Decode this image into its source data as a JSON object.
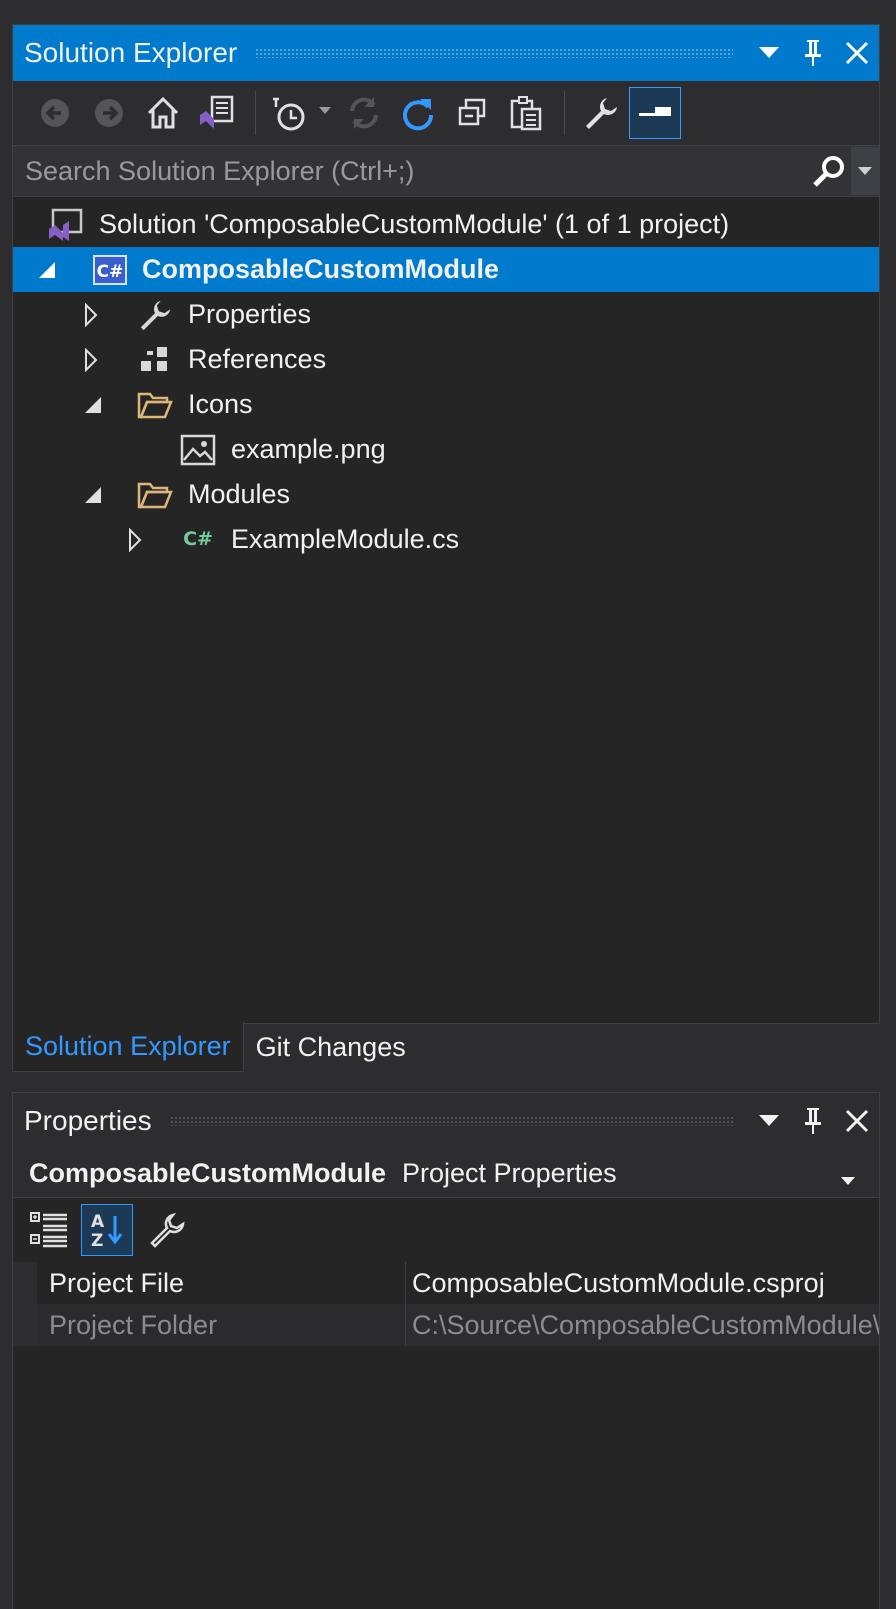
{
  "solution_explorer": {
    "title": "Solution Explorer",
    "search_placeholder": "Search Solution Explorer (Ctrl+;)",
    "solution_label": "Solution 'ComposableCustomModule' (1 of 1 project)",
    "project_label": "ComposableCustomModule",
    "nodes": {
      "properties": "Properties",
      "references": "References",
      "icons": "Icons",
      "example_png": "example.png",
      "modules": "Modules",
      "example_module": "ExampleModule.cs"
    }
  },
  "tabs": {
    "solution_explorer": "Solution Explorer",
    "git_changes": "Git Changes"
  },
  "properties": {
    "title": "Properties",
    "object_name": "ComposableCustomModule",
    "object_type": "Project Properties",
    "rows": [
      {
        "name": "Project File",
        "value": "ComposableCustomModule.csproj"
      },
      {
        "name": "Project Folder",
        "value": "C:\\Source\\ComposableCustomModule\\"
      }
    ]
  },
  "colors": {
    "accent": "#007acc",
    "background": "#252526",
    "chrome": "#2d2d30",
    "csharp_project": "#3a5fcd",
    "csharp_file": "#6fcf97",
    "folder": "#dcb67a",
    "vs_purple": "#865fc5"
  }
}
